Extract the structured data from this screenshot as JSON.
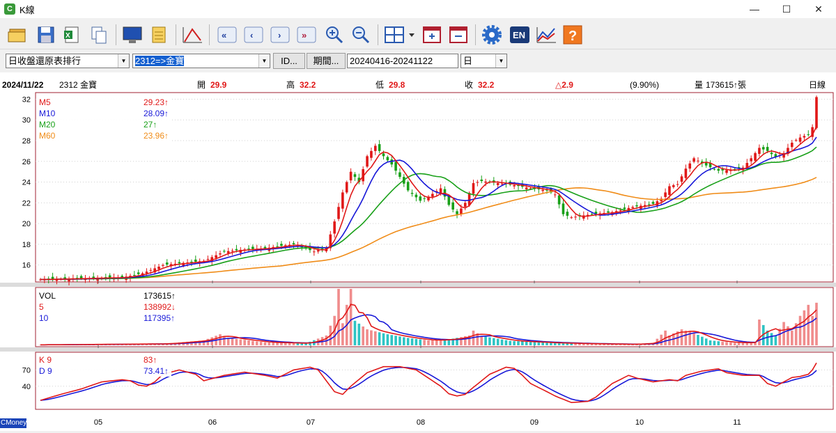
{
  "window": {
    "title": "K線",
    "app_icon": "cmoney-icon",
    "minimize": "—",
    "maximize": "☐",
    "close": "✕"
  },
  "toolbar": {
    "icons": [
      "open-folder-icon",
      "save-icon",
      "export-excel-icon",
      "copy-icon",
      "monitor-icon",
      "notes-icon",
      "draw-line-icon",
      "first-page-icon",
      "previous-icon",
      "next-icon",
      "last-page-icon",
      "zoom-in-icon",
      "zoom-out-icon",
      "layout-grid-icon",
      "add-panel-icon",
      "remove-panel-icon",
      "settings-icon",
      "english-icon",
      "trend-chart-icon",
      "help-icon"
    ],
    "en_label": "EN",
    "help_label": "?"
  },
  "selectors": {
    "report": "日收盤還原表排行",
    "stock": "2312=>金寶",
    "id_button": "ID...",
    "period_button": "期間...",
    "date_range": "20240416-20241122",
    "frequency": "日"
  },
  "info_bar": {
    "date": "2024/11/22",
    "stock": "2312 金寶",
    "open_label": "開",
    "open": "29.9",
    "high_label": "高",
    "high": "32.2",
    "low_label": "低",
    "low": "29.8",
    "close_label": "收",
    "close": "32.2",
    "change": "△2.9",
    "change_pct": "(9.90%)",
    "volume_label": "量",
    "volume": "173615↑張",
    "period": "日線"
  },
  "legend_price": [
    {
      "name": "M5",
      "value": "29.23↑",
      "color": "#e01818"
    },
    {
      "name": "M10",
      "value": "28.09↑",
      "color": "#1818d8"
    },
    {
      "name": "M20",
      "value": "27↑",
      "color": "#18a018"
    },
    {
      "name": "M60",
      "value": "23.96↑",
      "color": "#f08c18"
    }
  ],
  "legend_volume": [
    {
      "name": "VOL",
      "value": "173615↑",
      "color": "#000000"
    },
    {
      "name": "5",
      "value": "138992↓",
      "color": "#e01818"
    },
    {
      "name": "10",
      "value": "117395↑",
      "color": "#1818d8"
    }
  ],
  "legend_kd": [
    {
      "name": "K 9",
      "value": "83↑",
      "color": "#e01818"
    },
    {
      "name": "D 9",
      "value": "73.41↑",
      "color": "#1818d8"
    }
  ],
  "footer_label": "CMoney",
  "chart_data": {
    "type": "candlestick",
    "x_ticks": [
      "05",
      "06",
      "07",
      "08",
      "09",
      "10",
      "11"
    ],
    "price_y_ticks": [
      "32",
      "30",
      "28",
      "26",
      "24",
      "22",
      "20",
      "18",
      "16"
    ],
    "price_ylim": [
      14.5,
      32.5
    ],
    "kd_y_ticks": [
      "70",
      "40"
    ],
    "kd_ylim": [
      0,
      100
    ],
    "volume_max": 230000,
    "colors": {
      "up": "#e01818",
      "down": "#18a018",
      "up_vol": "#f08c8c",
      "down_vol": "#2ec4c4",
      "m5": "#e01818",
      "m10": "#1818d8",
      "m20": "#18a018",
      "m60": "#f08c18"
    },
    "close_key_points": [
      [
        0,
        14.6
      ],
      [
        10,
        14.7
      ],
      [
        20,
        14.8
      ],
      [
        25,
        15.2
      ],
      [
        30,
        16.0
      ],
      [
        40,
        16.4
      ],
      [
        45,
        17.3
      ],
      [
        50,
        17.5
      ],
      [
        55,
        17.6
      ],
      [
        58,
        17.8
      ],
      [
        62,
        18.0
      ],
      [
        67,
        17.3
      ],
      [
        70,
        17.7
      ],
      [
        72,
        20.2
      ],
      [
        74,
        23.0
      ],
      [
        76,
        25.0
      ],
      [
        78,
        24.0
      ],
      [
        80,
        26.5
      ],
      [
        82,
        27.5
      ],
      [
        84,
        26.5
      ],
      [
        86,
        25.7
      ],
      [
        88,
        24.5
      ],
      [
        90,
        23.2
      ],
      [
        93,
        22.2
      ],
      [
        95,
        22.6
      ],
      [
        98,
        23.4
      ],
      [
        100,
        21.8
      ],
      [
        102,
        20.9
      ],
      [
        104,
        22.0
      ],
      [
        106,
        23.9
      ],
      [
        108,
        24.1
      ],
      [
        112,
        23.9
      ],
      [
        116,
        23.7
      ],
      [
        120,
        23.4
      ],
      [
        124,
        23.2
      ],
      [
        126,
        22.8
      ],
      [
        128,
        20.9
      ],
      [
        130,
        20.6
      ],
      [
        135,
        20.9
      ],
      [
        140,
        21.1
      ],
      [
        145,
        21.6
      ],
      [
        150,
        21.9
      ],
      [
        152,
        22.4
      ],
      [
        154,
        23.6
      ],
      [
        156,
        23.8
      ],
      [
        158,
        25.3
      ],
      [
        160,
        26.3
      ],
      [
        163,
        25.6
      ],
      [
        166,
        25.1
      ],
      [
        170,
        25.2
      ],
      [
        172,
        25.4
      ],
      [
        174,
        26.3
      ],
      [
        176,
        27.3
      ],
      [
        178,
        27.0
      ],
      [
        180,
        26.4
      ],
      [
        182,
        26.8
      ],
      [
        184,
        27.8
      ],
      [
        186,
        28.3
      ],
      [
        188,
        28.6
      ],
      [
        189,
        29.3
      ],
      [
        190,
        32.2
      ]
    ],
    "volume_key_points": [
      [
        0,
        2000
      ],
      [
        30,
        6000
      ],
      [
        40,
        20000
      ],
      [
        44,
        45000
      ],
      [
        46,
        30000
      ],
      [
        55,
        12000
      ],
      [
        65,
        8000
      ],
      [
        70,
        40000
      ],
      [
        72,
        120000
      ],
      [
        73,
        230000
      ],
      [
        74,
        90000
      ],
      [
        75,
        165000
      ],
      [
        76,
        230000
      ],
      [
        77,
        100000
      ],
      [
        80,
        65000
      ],
      [
        85,
        45000
      ],
      [
        90,
        30000
      ],
      [
        95,
        20000
      ],
      [
        100,
        24000
      ],
      [
        105,
        40000
      ],
      [
        106,
        60000
      ],
      [
        108,
        38000
      ],
      [
        115,
        18000
      ],
      [
        125,
        10000
      ],
      [
        135,
        6000
      ],
      [
        145,
        4000
      ],
      [
        150,
        10000
      ],
      [
        153,
        60000
      ],
      [
        154,
        40000
      ],
      [
        157,
        65000
      ],
      [
        160,
        50000
      ],
      [
        164,
        20000
      ],
      [
        170,
        10000
      ],
      [
        175,
        12000
      ],
      [
        176,
        105000
      ],
      [
        178,
        60000
      ],
      [
        180,
        40000
      ],
      [
        182,
        95000
      ],
      [
        184,
        60000
      ],
      [
        186,
        120000
      ],
      [
        188,
        165000
      ],
      [
        189,
        120000
      ],
      [
        190,
        173615
      ]
    ],
    "kd_key_points": [
      [
        0,
        14
      ],
      [
        5,
        25
      ],
      [
        10,
        35
      ],
      [
        15,
        48
      ],
      [
        20,
        52
      ],
      [
        22,
        50
      ],
      [
        24,
        42
      ],
      [
        26,
        40
      ],
      [
        28,
        48
      ],
      [
        30,
        62
      ],
      [
        34,
        70
      ],
      [
        38,
        62
      ],
      [
        40,
        50
      ],
      [
        45,
        60
      ],
      [
        50,
        66
      ],
      [
        55,
        60
      ],
      [
        58,
        55
      ],
      [
        62,
        70
      ],
      [
        66,
        75
      ],
      [
        68,
        70
      ],
      [
        70,
        50
      ],
      [
        72,
        30
      ],
      [
        74,
        25
      ],
      [
        76,
        40
      ],
      [
        80,
        65
      ],
      [
        84,
        76
      ],
      [
        88,
        76
      ],
      [
        92,
        70
      ],
      [
        95,
        55
      ],
      [
        98,
        40
      ],
      [
        100,
        26
      ],
      [
        102,
        22
      ],
      [
        104,
        25
      ],
      [
        106,
        38
      ],
      [
        110,
        62
      ],
      [
        114,
        75
      ],
      [
        116,
        73
      ],
      [
        118,
        60
      ],
      [
        120,
        45
      ],
      [
        124,
        30
      ],
      [
        126,
        22
      ],
      [
        130,
        10
      ],
      [
        134,
        12
      ],
      [
        136,
        20
      ],
      [
        140,
        45
      ],
      [
        144,
        60
      ],
      [
        146,
        55
      ],
      [
        150,
        48
      ],
      [
        154,
        52
      ],
      [
        156,
        50
      ],
      [
        158,
        60
      ],
      [
        162,
        68
      ],
      [
        166,
        72
      ],
      [
        168,
        65
      ],
      [
        172,
        60
      ],
      [
        176,
        60
      ],
      [
        178,
        45
      ],
      [
        180,
        40
      ],
      [
        182,
        48
      ],
      [
        184,
        56
      ],
      [
        186,
        58
      ],
      [
        188,
        62
      ],
      [
        189,
        70
      ],
      [
        190,
        83
      ]
    ]
  }
}
